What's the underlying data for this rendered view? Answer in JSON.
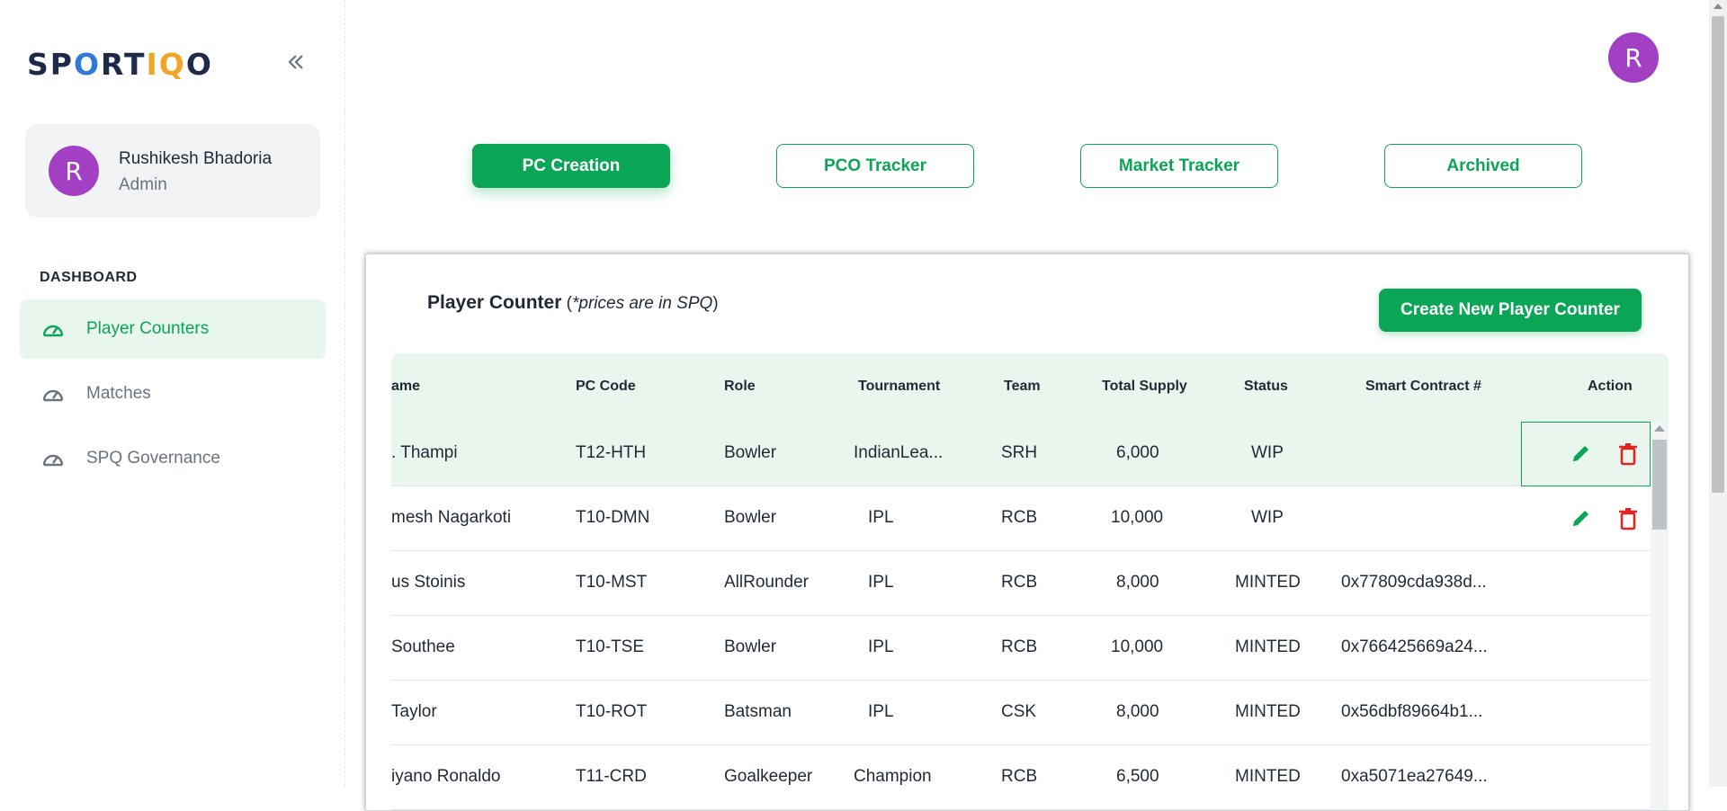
{
  "app": {
    "logo_prefix": "SP",
    "logo_pin": "O",
    "logo_mid": "RT",
    "logo_accent": "IQ",
    "logo_suffix": "O"
  },
  "user": {
    "initial": "R",
    "name": "Rushikesh Bhadoria",
    "role": "Admin"
  },
  "sidebar": {
    "section": "DASHBOARD",
    "items": [
      {
        "label": "Player Counters",
        "active": true
      },
      {
        "label": "Matches",
        "active": false
      },
      {
        "label": "SPQ Governance",
        "active": false
      }
    ]
  },
  "tabs": [
    {
      "label": "PC Creation",
      "active": true
    },
    {
      "label": "PCO Tracker",
      "active": false
    },
    {
      "label": "Market Tracker",
      "active": false
    },
    {
      "label": "Archived",
      "active": false
    }
  ],
  "panel": {
    "title": "Player Counter",
    "note_open": " (",
    "note": "*prices are in SPQ",
    "note_close": ")",
    "create_label": "Create New Player Counter"
  },
  "table": {
    "columns": [
      "ame",
      "PC Code",
      "Role",
      "Tournament",
      "Team",
      "Total Supply",
      "Status",
      "Smart Contract #",
      "Action"
    ],
    "rows": [
      {
        "name": ". Thampi",
        "code": "T12-HTH",
        "role": "Bowler",
        "tournament": "IndianLea...",
        "team": "SRH",
        "supply": "6,000",
        "status": "WIP",
        "contract": "",
        "editable": true
      },
      {
        "name": "mesh Nagarkoti",
        "code": "T10-DMN",
        "role": "Bowler",
        "tournament": "IPL",
        "team": "RCB",
        "supply": "10,000",
        "status": "WIP",
        "contract": "",
        "editable": true
      },
      {
        "name": "us Stoinis",
        "code": "T10-MST",
        "role": "AllRounder",
        "tournament": "IPL",
        "team": "RCB",
        "supply": "8,000",
        "status": "MINTED",
        "contract": "0x77809cda938d...",
        "editable": false
      },
      {
        "name": "Southee",
        "code": "T10-TSE",
        "role": "Bowler",
        "tournament": "IPL",
        "team": "RCB",
        "supply": "10,000",
        "status": "MINTED",
        "contract": "0x766425669a24...",
        "editable": false
      },
      {
        "name": " Taylor",
        "code": "T10-ROT",
        "role": "Batsman",
        "tournament": "IPL",
        "team": "CSK",
        "supply": "8,000",
        "status": "MINTED",
        "contract": "0x56dbf89664b1...",
        "editable": false
      },
      {
        "name": "iyano Ronaldo",
        "code": "T11-CRD",
        "role": "Goalkeeper",
        "tournament": "Champion",
        "team": "RCB",
        "supply": "6,500",
        "status": "MINTED",
        "contract": "0xa5071ea27649...",
        "editable": false
      }
    ]
  },
  "colors": {
    "accent": "#0aa656",
    "accent_light": "#e8f6ee",
    "avatar": "#a23fc3",
    "danger": "#e02424"
  },
  "icons": [
    "double-chevron-left-icon",
    "speedometer-icon",
    "pencil-icon",
    "trash-icon"
  ]
}
